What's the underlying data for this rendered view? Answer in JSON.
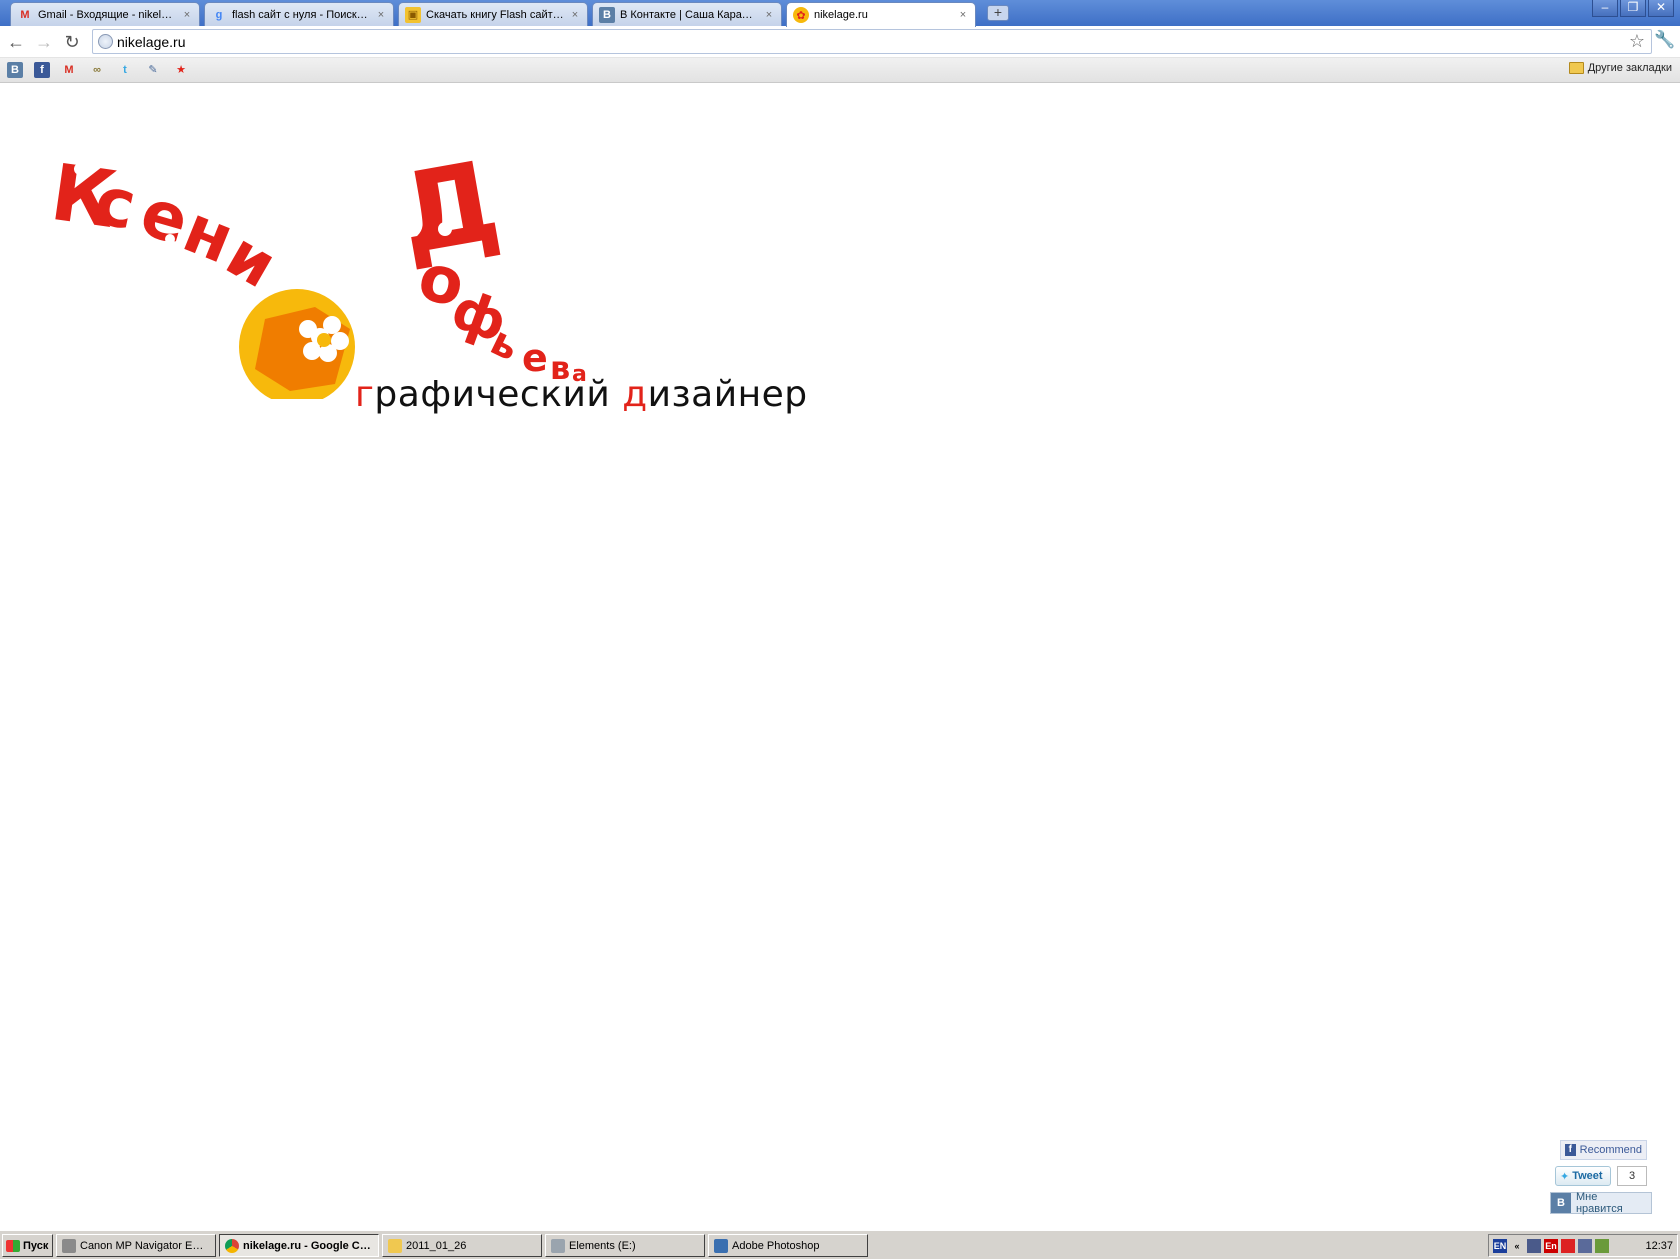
{
  "browser": {
    "tabs": [
      {
        "title": "Gmail - Входящие - nikelag…",
        "icon": "gmail-icon"
      },
      {
        "title": "flash сайт с нуля - Поиск …",
        "icon": "google-icon"
      },
      {
        "title": "Скачать книгу Flash сайт…",
        "icon": "box-icon"
      },
      {
        "title": "В Контакте | Саша Карач…",
        "icon": "vk-icon"
      },
      {
        "title": "nikelage.ru",
        "icon": "nikelage-icon"
      }
    ],
    "close_glyph": "×",
    "new_tab_glyph": "+",
    "window_controls": {
      "minimize": "–",
      "restore": "❐",
      "close": "✕"
    },
    "toolbar": {
      "back_glyph": "←",
      "forward_glyph": "→",
      "reload_glyph": "↻",
      "url": "nikelage.ru",
      "star_glyph": "☆",
      "wrench_glyph": "🔧"
    },
    "bookmarks": [
      {
        "label": "В",
        "icon": "vk-icon",
        "color": "#5b7fa6"
      },
      {
        "label": "f",
        "icon": "facebook-icon",
        "color": "#3b5998"
      },
      {
        "label": "M",
        "icon": "gmail-icon",
        "color": "#d93025"
      },
      {
        "label": "∞",
        "icon": "link-icon",
        "color": "#8a7a3a"
      },
      {
        "label": "t",
        "icon": "twitter-icon",
        "color": "#37a8e2"
      },
      {
        "label": "✎",
        "icon": "pen-icon",
        "color": "#4a6a9a"
      },
      {
        "label": "★",
        "icon": "star-icon",
        "color": "#e2231a"
      }
    ],
    "other_bookmarks": "Другие закладки"
  },
  "page": {
    "logo": {
      "name_line": "Ксения Дорофеева",
      "accent_red": "#e2231a",
      "sun_yellow": "#f7b90c",
      "sun_orange": "#f07d00"
    },
    "subtitle": {
      "first_letter": "г",
      "part1": "рафический ",
      "second_letter": "д",
      "part2": "изайнер"
    },
    "social": {
      "facebook_recommend": "Recommend",
      "tweet": "Tweet",
      "tweet_count": "3",
      "vk_like": "Мне нравится"
    }
  },
  "taskbar": {
    "start": "Пуск",
    "items": [
      {
        "label": "Canon MP Navigator EX -…",
        "icon": "scanner-icon",
        "active": false
      },
      {
        "label": "nikelage.ru - Google C…",
        "icon": "chrome-icon",
        "active": true
      },
      {
        "label": "2011_01_26",
        "icon": "folder-icon",
        "active": false
      },
      {
        "label": "Elements (E:)",
        "icon": "drive-icon",
        "active": false
      },
      {
        "label": "Adobe Photoshop",
        "icon": "photoshop-icon",
        "active": false
      }
    ],
    "tray": {
      "lang": "EN",
      "chevron": "«",
      "lang2": "En",
      "clock": "12:37"
    }
  }
}
